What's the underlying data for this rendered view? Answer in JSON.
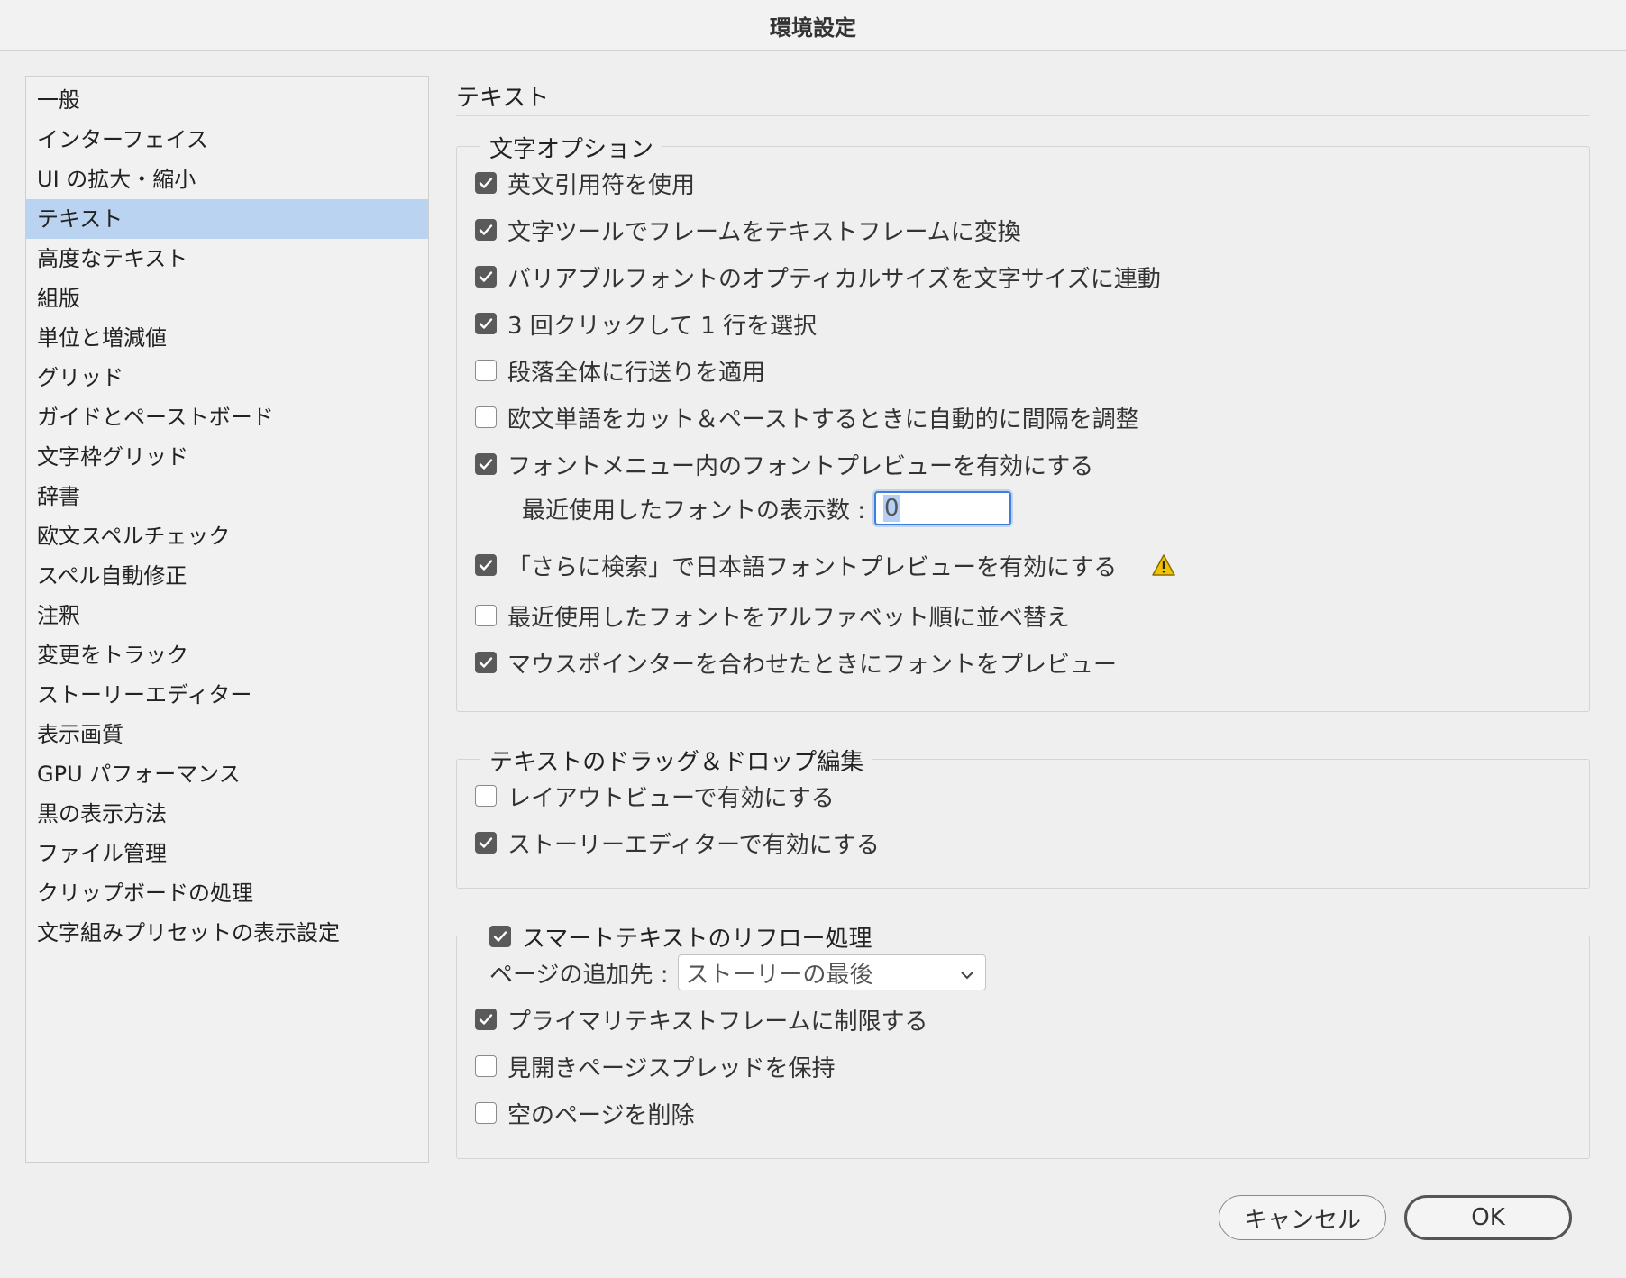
{
  "window": {
    "title": "環境設定"
  },
  "sidebar": {
    "items": [
      {
        "label": "一般"
      },
      {
        "label": "インターフェイス"
      },
      {
        "label": "UI の拡大・縮小"
      },
      {
        "label": "テキスト",
        "selected": true
      },
      {
        "label": "高度なテキスト"
      },
      {
        "label": "組版"
      },
      {
        "label": "単位と増減値"
      },
      {
        "label": "グリッド"
      },
      {
        "label": "ガイドとペーストボード"
      },
      {
        "label": "文字枠グリッド"
      },
      {
        "label": "辞書"
      },
      {
        "label": "欧文スペルチェック"
      },
      {
        "label": "スペル自動修正"
      },
      {
        "label": "注釈"
      },
      {
        "label": "変更をトラック"
      },
      {
        "label": "ストーリーエディター"
      },
      {
        "label": "表示画質"
      },
      {
        "label": "GPU パフォーマンス"
      },
      {
        "label": "黒の表示方法"
      },
      {
        "label": "ファイル管理"
      },
      {
        "label": "クリップボードの処理"
      },
      {
        "label": "文字組みプリセットの表示設定"
      }
    ]
  },
  "panel": {
    "heading": "テキスト",
    "char_options": {
      "legend": "文字オプション",
      "items": [
        {
          "label": "英文引用符を使用",
          "checked": true
        },
        {
          "label": "文字ツールでフレームをテキストフレームに変換",
          "checked": true
        },
        {
          "label": "バリアブルフォントのオプティカルサイズを文字サイズに連動",
          "checked": true
        },
        {
          "label": "3 回クリックして 1 行を選択",
          "checked": true
        },
        {
          "label": "段落全体に行送りを適用",
          "checked": false
        },
        {
          "label": "欧文単語をカット＆ペーストするときに自動的に間隔を調整",
          "checked": false
        },
        {
          "label": "フォントメニュー内のフォントプレビューを有効にする",
          "checked": true
        }
      ],
      "recent_fonts_label": "最近使用したフォントの表示数 :",
      "recent_fonts_value": "0",
      "items2": [
        {
          "label": "「さらに検索」で日本語フォントプレビューを有効にする",
          "checked": true
        },
        {
          "label": "最近使用したフォントをアルファベット順に並べ替え",
          "checked": false
        },
        {
          "label": "マウスポインターを合わせたときにフォントをプレビュー",
          "checked": true
        }
      ],
      "warning_icon": "warning-triangle-icon"
    },
    "drag_drop": {
      "legend": "テキストのドラッグ＆ドロップ編集",
      "items": [
        {
          "label": "レイアウトビューで有効にする",
          "checked": false
        },
        {
          "label": "ストーリーエディターで有効にする",
          "checked": true
        }
      ]
    },
    "smart_reflow": {
      "legend": "スマートテキストのリフロー処理",
      "legend_checked": true,
      "add_pages_label": "ページの追加先 :",
      "add_pages_value": "ストーリーの最後",
      "items": [
        {
          "label": "プライマリテキストフレームに制限する",
          "checked": true
        },
        {
          "label": "見開きページスプレッドを保持",
          "checked": false
        },
        {
          "label": "空のページを削除",
          "checked": false
        }
      ]
    }
  },
  "buttons": {
    "cancel": "キャンセル",
    "ok": "OK"
  },
  "colors": {
    "selection": "#b9d3f0",
    "focus": "#3d7fe0",
    "checkbox_on": "#5a5a5a",
    "warning": "#f2c200"
  }
}
